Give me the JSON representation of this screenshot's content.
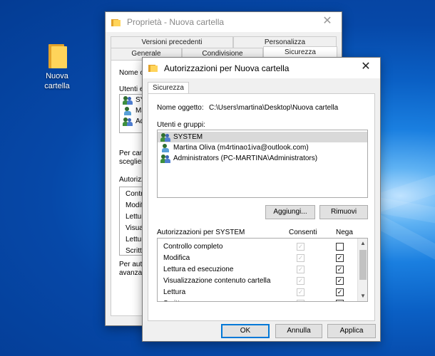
{
  "desktop": {
    "icon_label": "Nuova cartella"
  },
  "back_window": {
    "title": "Proprietà - Nuova cartella",
    "tabs_row1": [
      "Versioni precedenti",
      "Personalizza"
    ],
    "tabs_row2": [
      "Generale",
      "Condivisione",
      "Sicurezza"
    ],
    "object_label": "Nome o",
    "users_label": "Utenti e",
    "users": [
      "SYS",
      "Ma",
      "Adr"
    ],
    "change_text_1": "Per cam",
    "change_text_2": "sceglier",
    "perm_label": "Autorizz",
    "perms": [
      "Contr",
      "Modifi",
      "Lettur",
      "Visual",
      "Lettur",
      "Scritt"
    ],
    "adv_text_1": "Per aute",
    "adv_text_2": "avanzat"
  },
  "front_window": {
    "title": "Autorizzazioni per Nuova cartella",
    "tab": "Sicurezza",
    "object_label": "Nome oggetto:",
    "object_path": "C:\\Users\\martina\\Desktop\\Nuova cartella",
    "users_label": "Utenti e gruppi:",
    "users": [
      {
        "name": "SYSTEM",
        "icon": "users-group-icon"
      },
      {
        "name": "Martina Oliva (m4rtinao1iva@outlook.com)",
        "icon": "user-icon"
      },
      {
        "name": "Administrators (PC-MARTINA\\Administrators)",
        "icon": "users-group-icon"
      }
    ],
    "add_button": "Aggiungi...",
    "remove_button": "Rimuovi",
    "perms_header": "Autorizzazioni per SYSTEM",
    "allow_header": "Consenti",
    "deny_header": "Nega",
    "perms": [
      {
        "name": "Controllo completo",
        "allow": true,
        "deny": false
      },
      {
        "name": "Modifica",
        "allow": true,
        "deny": true
      },
      {
        "name": "Lettura ed esecuzione",
        "allow": true,
        "deny": true
      },
      {
        "name": "Visualizzazione contenuto cartella",
        "allow": true,
        "deny": true
      },
      {
        "name": "Lettura",
        "allow": true,
        "deny": true
      },
      {
        "name": "Scrittura",
        "allow": true,
        "deny": true
      }
    ],
    "ok_button": "OK",
    "cancel_button": "Annulla",
    "apply_button": "Applica",
    "check_glyph": "✓",
    "close_glyph": "✕"
  }
}
